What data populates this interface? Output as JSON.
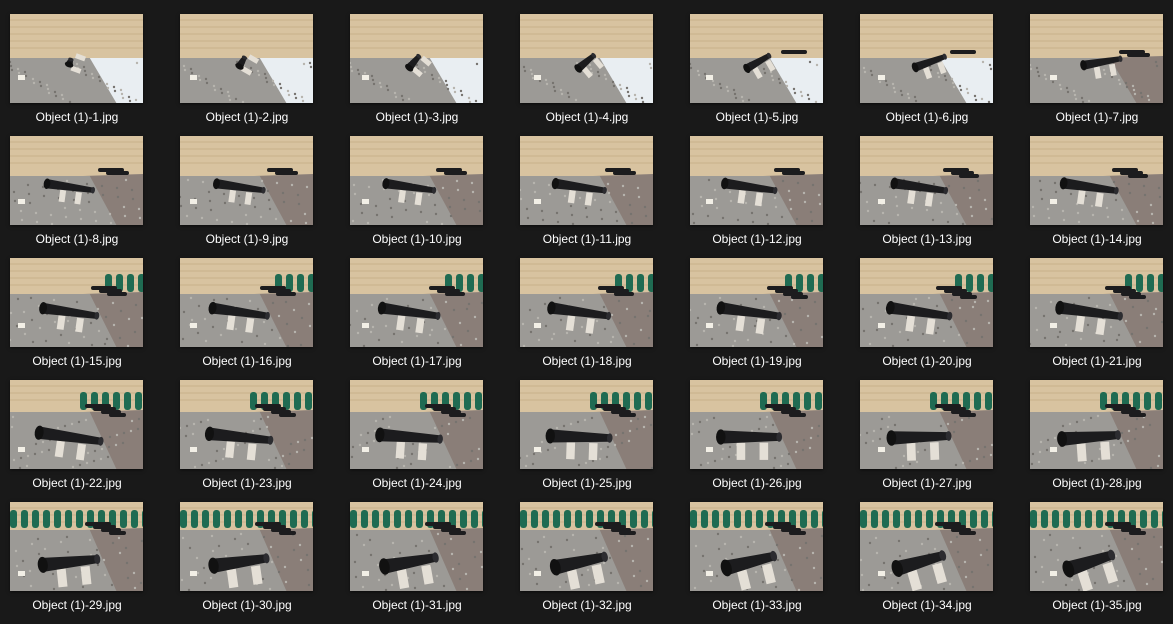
{
  "files": [
    {
      "name": "Object (1)-1.jpg"
    },
    {
      "name": "Object (1)-2.jpg"
    },
    {
      "name": "Object (1)-3.jpg"
    },
    {
      "name": "Object (1)-4.jpg"
    },
    {
      "name": "Object (1)-5.jpg"
    },
    {
      "name": "Object (1)-6.jpg"
    },
    {
      "name": "Object (1)-7.jpg"
    },
    {
      "name": "Object (1)-8.jpg"
    },
    {
      "name": "Object (1)-9.jpg"
    },
    {
      "name": "Object (1)-10.jpg"
    },
    {
      "name": "Object (1)-11.jpg"
    },
    {
      "name": "Object (1)-12.jpg"
    },
    {
      "name": "Object (1)-13.jpg"
    },
    {
      "name": "Object (1)-14.jpg"
    },
    {
      "name": "Object (1)-15.jpg"
    },
    {
      "name": "Object (1)-16.jpg"
    },
    {
      "name": "Object (1)-17.jpg"
    },
    {
      "name": "Object (1)-18.jpg"
    },
    {
      "name": "Object (1)-19.jpg"
    },
    {
      "name": "Object (1)-20.jpg"
    },
    {
      "name": "Object (1)-21.jpg"
    },
    {
      "name": "Object (1)-22.jpg"
    },
    {
      "name": "Object (1)-23.jpg"
    },
    {
      "name": "Object (1)-24.jpg"
    },
    {
      "name": "Object (1)-25.jpg"
    },
    {
      "name": "Object (1)-26.jpg"
    },
    {
      "name": "Object (1)-27.jpg"
    },
    {
      "name": "Object (1)-28.jpg"
    },
    {
      "name": "Object (1)-29.jpg"
    },
    {
      "name": "Object (1)-30.jpg"
    },
    {
      "name": "Object (1)-31.jpg"
    },
    {
      "name": "Object (1)-32.jpg"
    },
    {
      "name": "Object (1)-33.jpg"
    },
    {
      "name": "Object (1)-34.jpg"
    },
    {
      "name": "Object (1)-35.jpg"
    }
  ],
  "colors": {
    "background": "#191919",
    "caption_text": "#ffffff",
    "wall": "#d8c3a0",
    "gravel": "#9c9a96",
    "cannon": "#1c1c1e",
    "green_door": "#1f6b52"
  }
}
